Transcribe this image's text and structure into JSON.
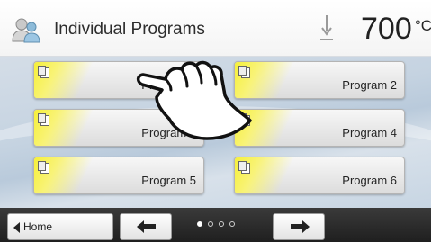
{
  "header": {
    "title": "Individual Programs",
    "temperature": "700",
    "temperature_unit": "°C",
    "user_icon": "user-group-icon",
    "thermometer_icon": "temperature-arrow-icon"
  },
  "programs": [
    {
      "label": "Program 1"
    },
    {
      "label": "Program 2"
    },
    {
      "label": "Program 3"
    },
    {
      "label": "Program 4"
    },
    {
      "label": "Program 5"
    },
    {
      "label": "Program 6"
    }
  ],
  "footer": {
    "home_label": "Home",
    "page_indicator": {
      "current": 1,
      "total": 4
    }
  },
  "colors": {
    "accent_yellow": "#f6f03a",
    "footer_bg": "#2a2a2a",
    "content_bg": "#c5d3e1"
  }
}
